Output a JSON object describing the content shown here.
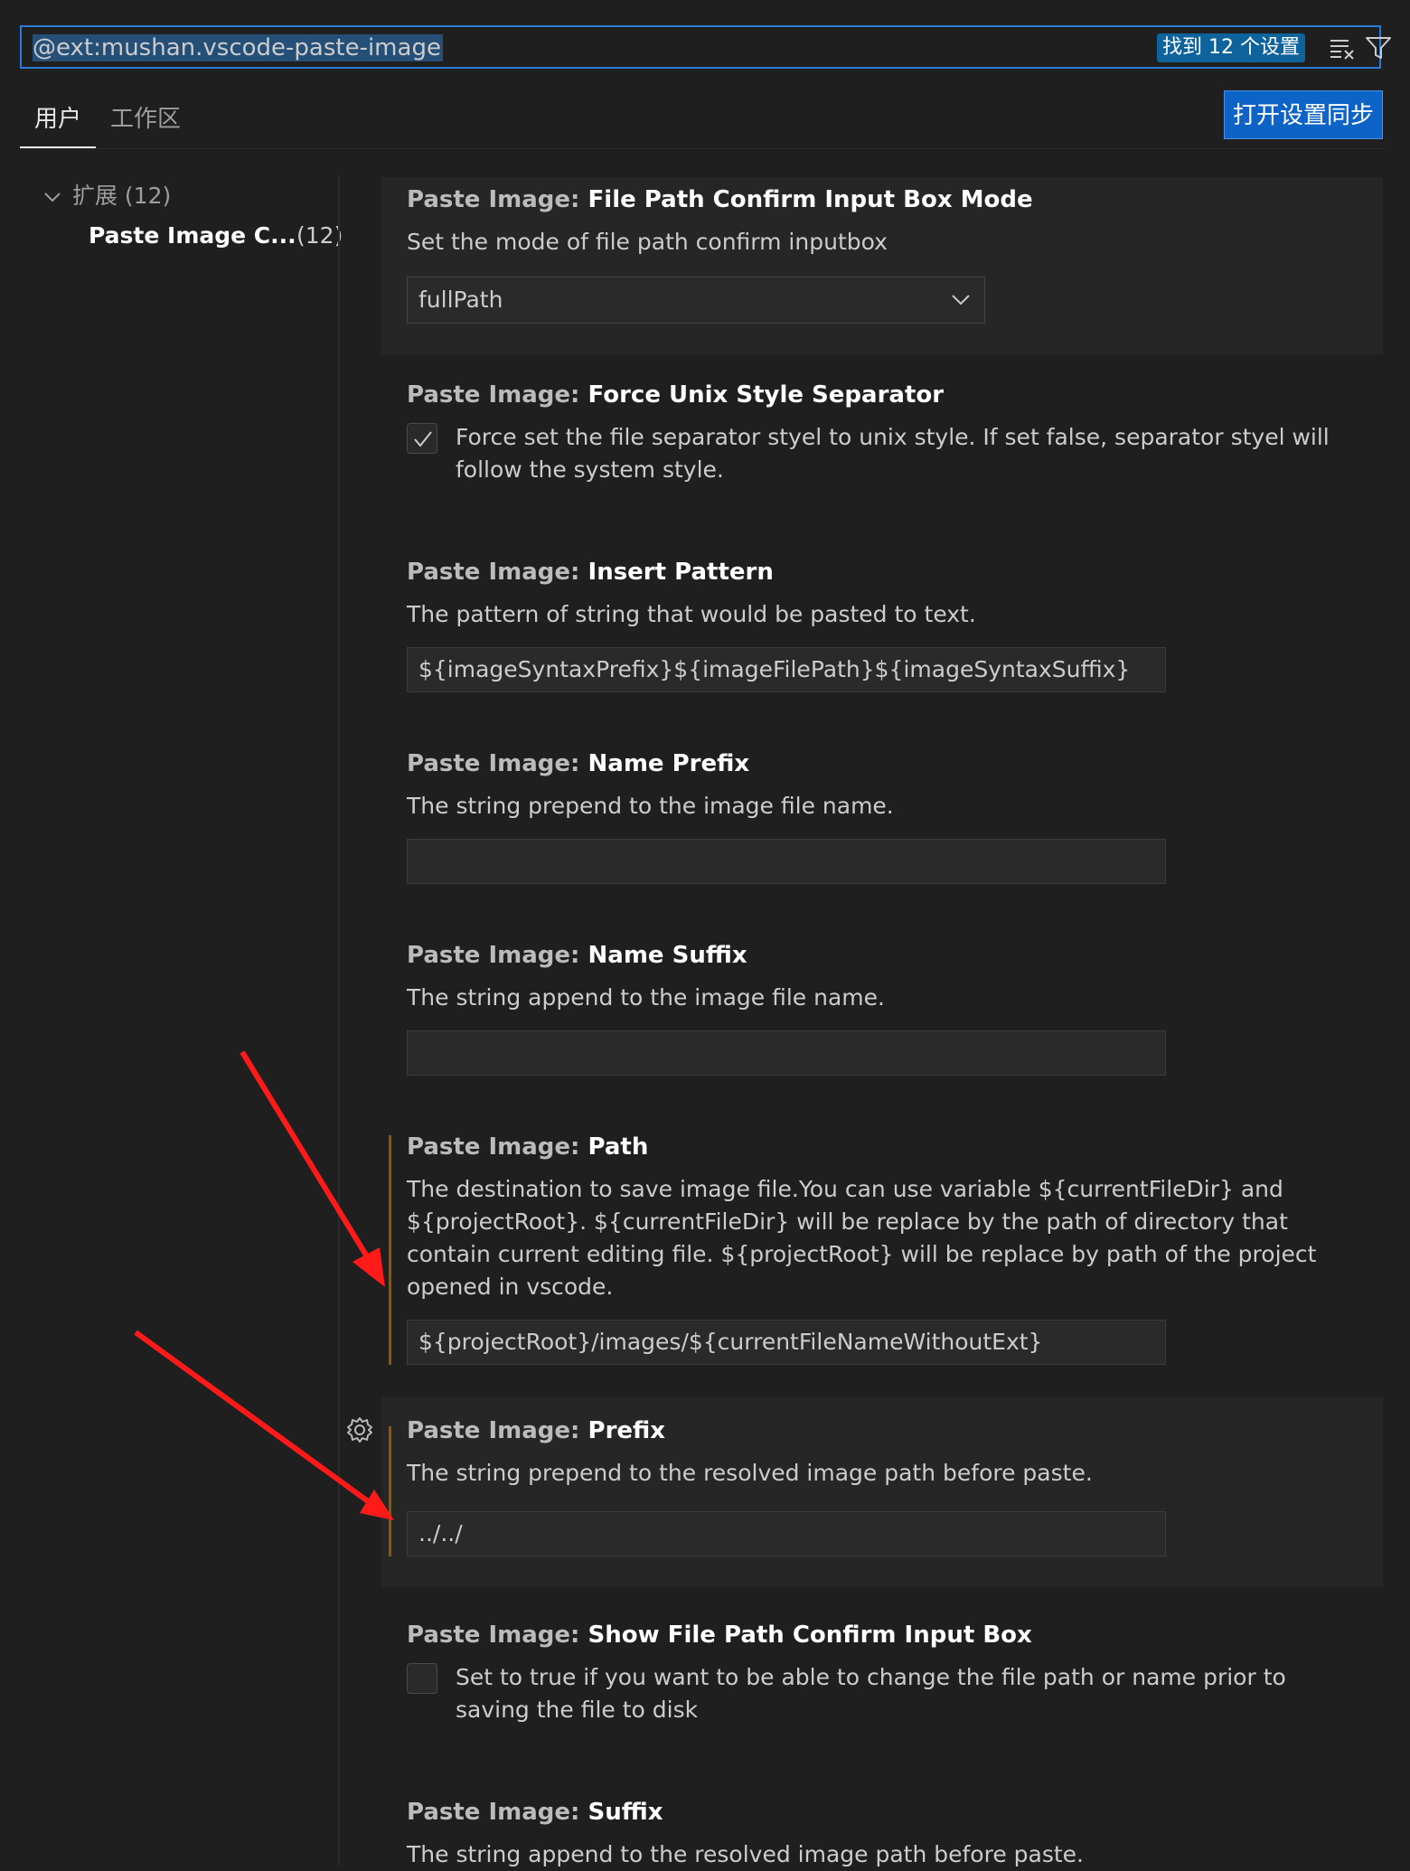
{
  "search": {
    "query": "@ext:mushan.vscode-paste-image",
    "result_count": "找到 12 个设置"
  },
  "tabs": [
    {
      "label": "用户"
    },
    {
      "label": "工作区"
    }
  ],
  "sync_button": "打开设置同步",
  "sidebar": {
    "group_label": "扩展",
    "group_count": "(12)",
    "item_label": "Paste Image C...",
    "item_count": "(12)"
  },
  "settings": [
    {
      "category": "Paste Image:",
      "name": "File Path Confirm Input Box Mode",
      "description": "Set the mode of file path confirm inputbox",
      "control": "select",
      "value": "fullPath"
    },
    {
      "category": "Paste Image:",
      "name": "Force Unix Style Separator",
      "description": "Force set the file separator styel to unix style. If set false, separator styel will follow the system style.",
      "control": "checkbox",
      "checked": true
    },
    {
      "category": "Paste Image:",
      "name": "Insert Pattern",
      "description": "The pattern of string that would be pasted to text.",
      "control": "text",
      "value": "${imageSyntaxPrefix}${imageFilePath}${imageSyntaxSuffix}"
    },
    {
      "category": "Paste Image:",
      "name": "Name Prefix",
      "description": "The string prepend to the image file name.",
      "control": "text",
      "value": ""
    },
    {
      "category": "Paste Image:",
      "name": "Name Suffix",
      "description": "The string append to the image file name.",
      "control": "text",
      "value": ""
    },
    {
      "category": "Paste Image:",
      "name": "Path",
      "description": "The destination to save image file.You can use variable ${currentFileDir} and ${projectRoot}. ${currentFileDir} will be replace by the path of directory that contain current editing file. ${projectRoot} will be replace by path of the project opened in vscode.",
      "control": "text",
      "value": "${projectRoot}/images/${currentFileNameWithoutExt}"
    },
    {
      "category": "Paste Image:",
      "name": "Prefix",
      "description": "The string prepend to the resolved image path before paste.",
      "control": "text",
      "value": "../../"
    },
    {
      "category": "Paste Image:",
      "name": "Show File Path Confirm Input Box",
      "description": "Set to true if you want to be able to change the file path or name prior to saving the file to disk",
      "control": "checkbox",
      "checked": false
    },
    {
      "category": "Paste Image:",
      "name": "Suffix",
      "description": "The string append to the resolved image path before paste.",
      "control": "text",
      "value": ""
    }
  ],
  "colors": {
    "accent": "#0e63c6",
    "modified_indicator": "#7a5a2a",
    "annotation_arrow": "#ff1a1a"
  },
  "icons": [
    "clear-filter-icon",
    "filter-icon",
    "chevron-down-icon",
    "checkmark-icon",
    "gear-icon"
  ]
}
